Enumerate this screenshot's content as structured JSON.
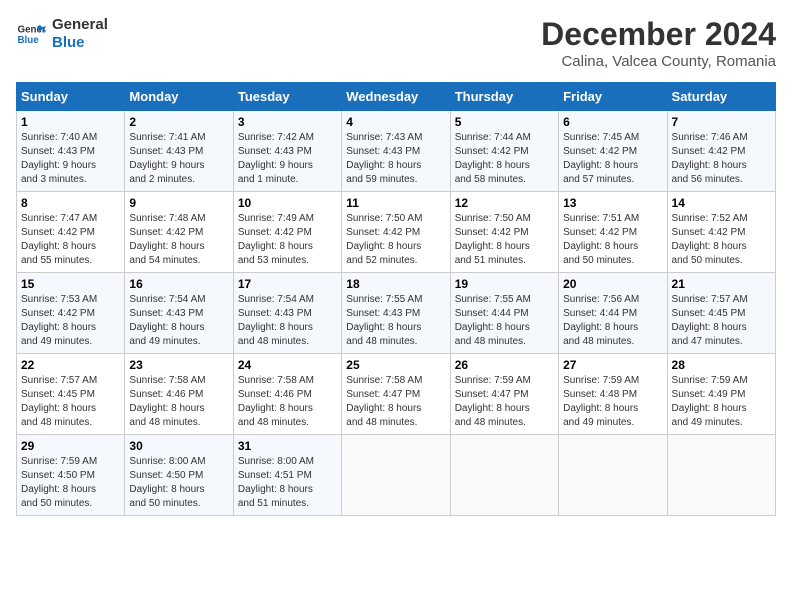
{
  "logo": {
    "text_general": "General",
    "text_blue": "Blue"
  },
  "title": "December 2024",
  "subtitle": "Calina, Valcea County, Romania",
  "days_of_week": [
    "Sunday",
    "Monday",
    "Tuesday",
    "Wednesday",
    "Thursday",
    "Friday",
    "Saturday"
  ],
  "weeks": [
    [
      {
        "day": "1",
        "info": "Sunrise: 7:40 AM\nSunset: 4:43 PM\nDaylight: 9 hours\nand 3 minutes."
      },
      {
        "day": "2",
        "info": "Sunrise: 7:41 AM\nSunset: 4:43 PM\nDaylight: 9 hours\nand 2 minutes."
      },
      {
        "day": "3",
        "info": "Sunrise: 7:42 AM\nSunset: 4:43 PM\nDaylight: 9 hours\nand 1 minute."
      },
      {
        "day": "4",
        "info": "Sunrise: 7:43 AM\nSunset: 4:43 PM\nDaylight: 8 hours\nand 59 minutes."
      },
      {
        "day": "5",
        "info": "Sunrise: 7:44 AM\nSunset: 4:42 PM\nDaylight: 8 hours\nand 58 minutes."
      },
      {
        "day": "6",
        "info": "Sunrise: 7:45 AM\nSunset: 4:42 PM\nDaylight: 8 hours\nand 57 minutes."
      },
      {
        "day": "7",
        "info": "Sunrise: 7:46 AM\nSunset: 4:42 PM\nDaylight: 8 hours\nand 56 minutes."
      }
    ],
    [
      {
        "day": "8",
        "info": "Sunrise: 7:47 AM\nSunset: 4:42 PM\nDaylight: 8 hours\nand 55 minutes."
      },
      {
        "day": "9",
        "info": "Sunrise: 7:48 AM\nSunset: 4:42 PM\nDaylight: 8 hours\nand 54 minutes."
      },
      {
        "day": "10",
        "info": "Sunrise: 7:49 AM\nSunset: 4:42 PM\nDaylight: 8 hours\nand 53 minutes."
      },
      {
        "day": "11",
        "info": "Sunrise: 7:50 AM\nSunset: 4:42 PM\nDaylight: 8 hours\nand 52 minutes."
      },
      {
        "day": "12",
        "info": "Sunrise: 7:50 AM\nSunset: 4:42 PM\nDaylight: 8 hours\nand 51 minutes."
      },
      {
        "day": "13",
        "info": "Sunrise: 7:51 AM\nSunset: 4:42 PM\nDaylight: 8 hours\nand 50 minutes."
      },
      {
        "day": "14",
        "info": "Sunrise: 7:52 AM\nSunset: 4:42 PM\nDaylight: 8 hours\nand 50 minutes."
      }
    ],
    [
      {
        "day": "15",
        "info": "Sunrise: 7:53 AM\nSunset: 4:42 PM\nDaylight: 8 hours\nand 49 minutes."
      },
      {
        "day": "16",
        "info": "Sunrise: 7:54 AM\nSunset: 4:43 PM\nDaylight: 8 hours\nand 49 minutes."
      },
      {
        "day": "17",
        "info": "Sunrise: 7:54 AM\nSunset: 4:43 PM\nDaylight: 8 hours\nand 48 minutes."
      },
      {
        "day": "18",
        "info": "Sunrise: 7:55 AM\nSunset: 4:43 PM\nDaylight: 8 hours\nand 48 minutes."
      },
      {
        "day": "19",
        "info": "Sunrise: 7:55 AM\nSunset: 4:44 PM\nDaylight: 8 hours\nand 48 minutes."
      },
      {
        "day": "20",
        "info": "Sunrise: 7:56 AM\nSunset: 4:44 PM\nDaylight: 8 hours\nand 48 minutes."
      },
      {
        "day": "21",
        "info": "Sunrise: 7:57 AM\nSunset: 4:45 PM\nDaylight: 8 hours\nand 47 minutes."
      }
    ],
    [
      {
        "day": "22",
        "info": "Sunrise: 7:57 AM\nSunset: 4:45 PM\nDaylight: 8 hours\nand 48 minutes."
      },
      {
        "day": "23",
        "info": "Sunrise: 7:58 AM\nSunset: 4:46 PM\nDaylight: 8 hours\nand 48 minutes."
      },
      {
        "day": "24",
        "info": "Sunrise: 7:58 AM\nSunset: 4:46 PM\nDaylight: 8 hours\nand 48 minutes."
      },
      {
        "day": "25",
        "info": "Sunrise: 7:58 AM\nSunset: 4:47 PM\nDaylight: 8 hours\nand 48 minutes."
      },
      {
        "day": "26",
        "info": "Sunrise: 7:59 AM\nSunset: 4:47 PM\nDaylight: 8 hours\nand 48 minutes."
      },
      {
        "day": "27",
        "info": "Sunrise: 7:59 AM\nSunset: 4:48 PM\nDaylight: 8 hours\nand 49 minutes."
      },
      {
        "day": "28",
        "info": "Sunrise: 7:59 AM\nSunset: 4:49 PM\nDaylight: 8 hours\nand 49 minutes."
      }
    ],
    [
      {
        "day": "29",
        "info": "Sunrise: 7:59 AM\nSunset: 4:50 PM\nDaylight: 8 hours\nand 50 minutes."
      },
      {
        "day": "30",
        "info": "Sunrise: 8:00 AM\nSunset: 4:50 PM\nDaylight: 8 hours\nand 50 minutes."
      },
      {
        "day": "31",
        "info": "Sunrise: 8:00 AM\nSunset: 4:51 PM\nDaylight: 8 hours\nand 51 minutes."
      },
      {
        "day": "",
        "info": ""
      },
      {
        "day": "",
        "info": ""
      },
      {
        "day": "",
        "info": ""
      },
      {
        "day": "",
        "info": ""
      }
    ]
  ]
}
